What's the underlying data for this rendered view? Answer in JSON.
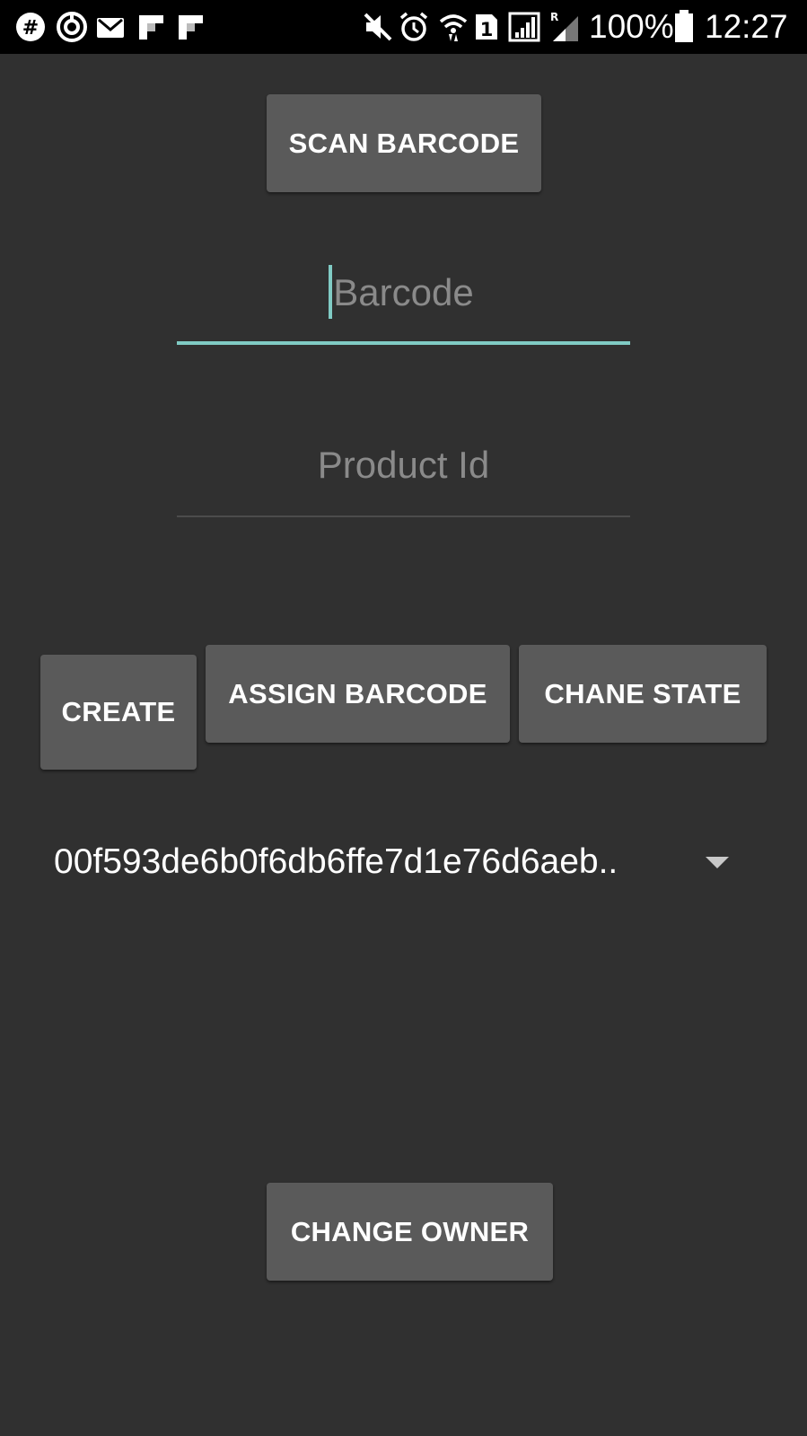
{
  "status_bar": {
    "battery": "100%",
    "time": "12:27",
    "sim_slot": "1",
    "roaming": "R",
    "icons": [
      "slack-icon",
      "sync-icon",
      "mail-icon",
      "flipboard-icon",
      "flipboard-icon",
      "mute-icon",
      "alarm-icon",
      "wifi-icon",
      "sim-icon",
      "signal-icon",
      "signal-roaming-icon",
      "battery-icon"
    ]
  },
  "buttons": {
    "scan_barcode": "SCAN BARCODE",
    "create": "CREATE",
    "assign_barcode": "ASSIGN BARCODE",
    "change_state": "CHANE STATE",
    "change_owner": "CHANGE OWNER"
  },
  "fields": {
    "barcode_placeholder": "Barcode",
    "product_id_placeholder": "Product Id"
  },
  "spinner": {
    "selected": "00f593de6b0f6db6ffe7d1e76d6aeb.."
  },
  "colors": {
    "background": "#303030",
    "button": "#5a5a5a",
    "accent": "#80cbc4",
    "hint": "#8a8a8a"
  }
}
